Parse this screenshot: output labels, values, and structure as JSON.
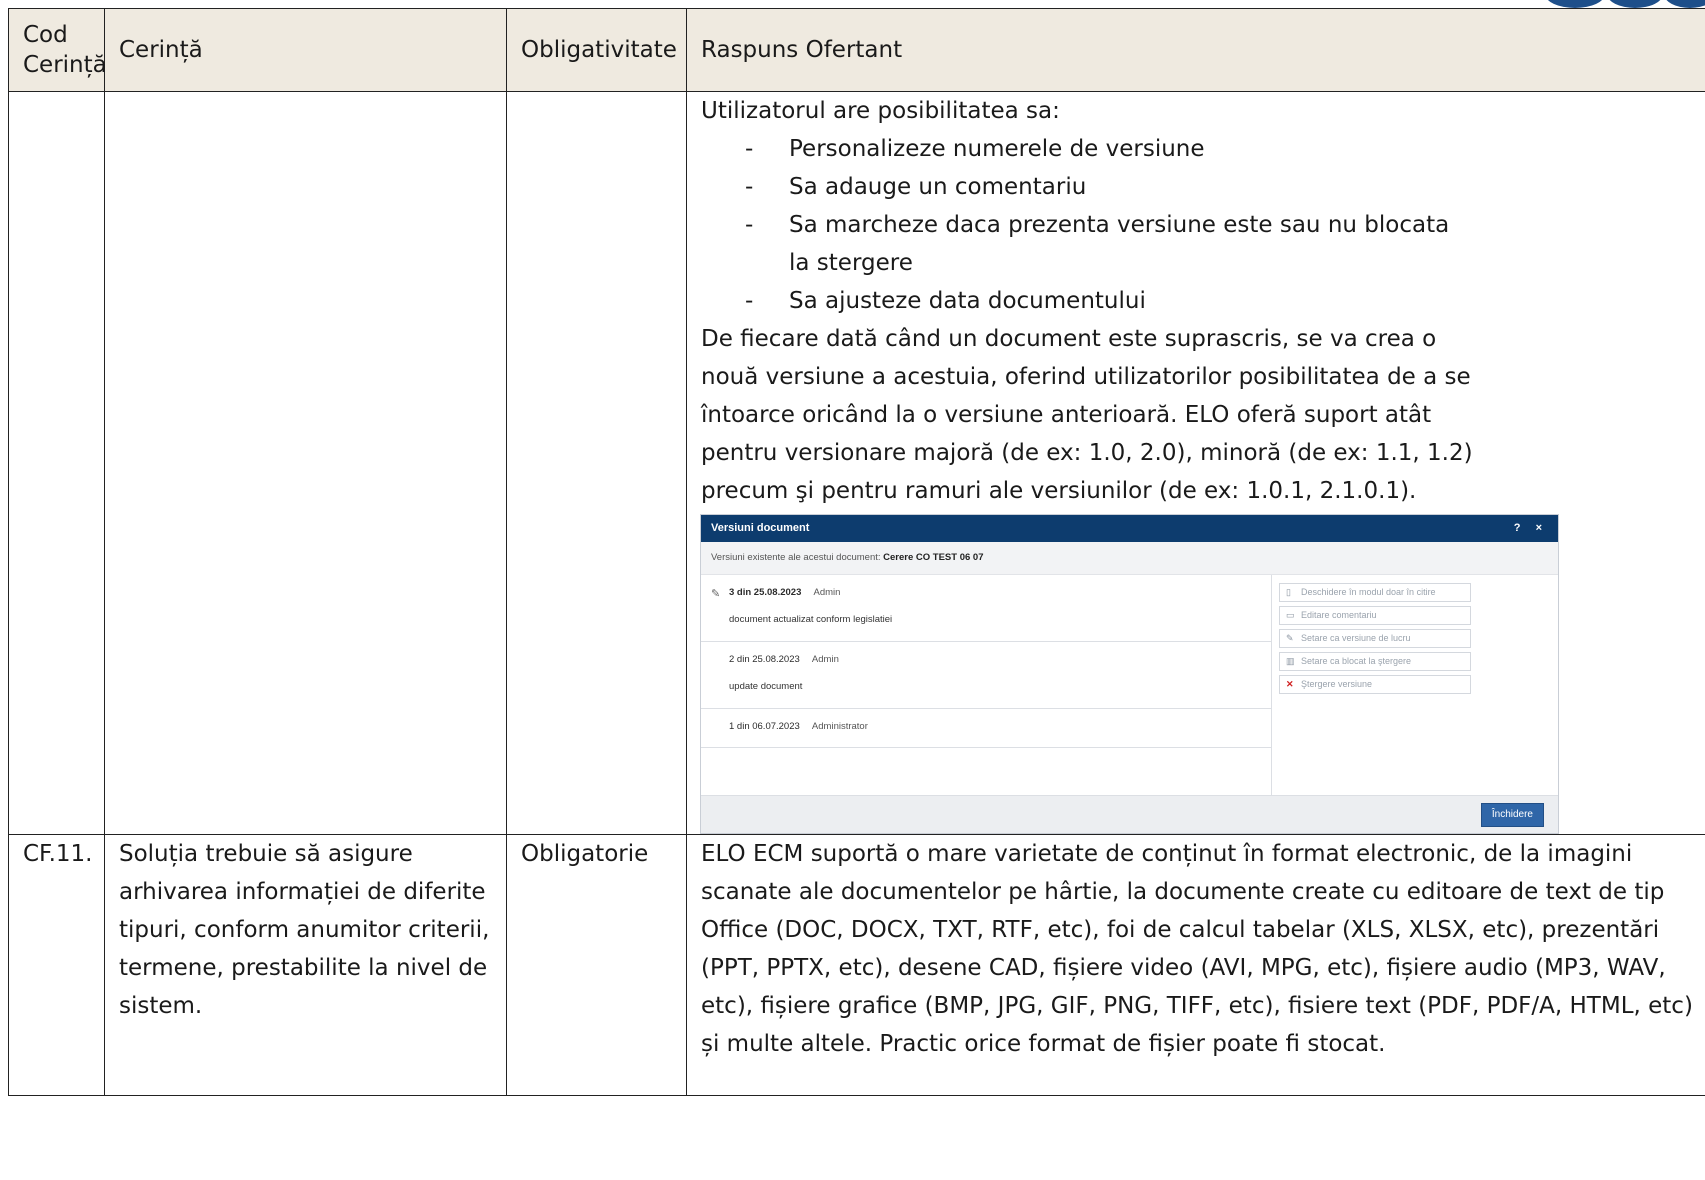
{
  "header": {
    "col1": "Cod Cerință",
    "col2": "Cerință",
    "col3": "Obligativitate",
    "col4": "Raspuns Ofertant"
  },
  "row1": {
    "intro": "Utilizatorul are posibilitatea sa:",
    "bullets": [
      "Personalizeze numerele de versiune",
      "Sa adauge un comentariu",
      "Sa marcheze daca prezenta versiune este sau nu blocata la stergere",
      "Sa ajusteze data documentului"
    ],
    "paragraph": "De fiecare dată când un document este suprascris, se va crea o nouă versiune a acestuia, oferind utilizatorilor posibilitatea de a se întoarce oricând la o versiune anterioară. ELO oferă suport atât pentru versionare majoră (de ex: 1.0, 2.0), minoră (de ex: 1.1, 1.2) precum şi pentru ramuri ale versiunilor (de ex: 1.0.1, 2.1.0.1).",
    "dialog": {
      "title": "Versiuni document",
      "controls": "? ×",
      "subtitle_prefix": "Versiuni existente ale acestui document:",
      "subtitle_doc": "Cerere CO TEST 06 07",
      "versions": [
        {
          "date": "3 din 25.08.2023",
          "user": "Admin",
          "comment": "document actualizat conform legislatiei"
        },
        {
          "date": "2 din 25.08.2023",
          "user": "Admin",
          "comment": "update document"
        },
        {
          "date": "1 din 06.07.2023",
          "user": "Administrator",
          "comment": ""
        }
      ],
      "actions": [
        "Deschidere în modul doar în citire",
        "Editare comentariu",
        "Setare ca versiune de lucru",
        "Setare ca blocat la ştergere",
        "Ştergere versiune"
      ],
      "close_label": "Închidere"
    }
  },
  "row2": {
    "code": "CF.11.",
    "requirement": "Soluția trebuie să asigure arhivarea informației de diferite tipuri, conform anumitor criterii, termene, prestabilite la nivel de sistem.",
    "mandatory": "Obligatorie",
    "response": "ELO ECM suportă o mare varietate de conținut în format electronic, de la imagini scanate ale documentelor pe hârtie, la documente create cu editoare de text de tip Office (DOC, DOCX, TXT, RTF, etc), foi de calcul tabelar (XLS, XLSX, etc), prezentări (PPT, PPTX, etc), desene CAD, fișiere video (AVI, MPG, etc), fișiere audio (MP3, WAV, etc), fișiere grafice (BMP, JPG, GIF, PNG, TIFF, etc), fisiere text (PDF, PDF/A, HTML, etc) și multe altele. Practic orice format de fișier poate fi stocat."
  }
}
